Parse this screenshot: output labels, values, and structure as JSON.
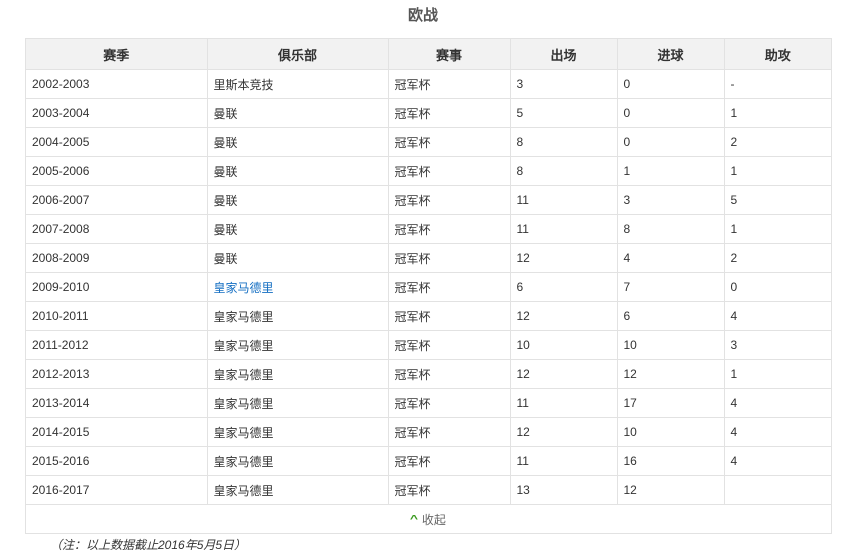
{
  "title": "欧战",
  "headers": [
    "赛季",
    "俱乐部",
    "赛事",
    "出场",
    "进球",
    "助攻"
  ],
  "rows": [
    [
      "2002-2003",
      "里斯本竞技",
      "冠军杯",
      "3",
      "0",
      "-"
    ],
    [
      "2003-2004",
      "曼联",
      "冠军杯",
      "5",
      "0",
      "1"
    ],
    [
      "2004-2005",
      "曼联",
      "冠军杯",
      "8",
      "0",
      "2"
    ],
    [
      "2005-2006",
      "曼联",
      "冠军杯",
      "8",
      "1",
      "1"
    ],
    [
      "2006-2007",
      "曼联",
      "冠军杯",
      "11",
      "3",
      "5"
    ],
    [
      "2007-2008",
      "曼联",
      "冠军杯",
      "11",
      "8",
      "1"
    ],
    [
      "2008-2009",
      "曼联",
      "冠军杯",
      "12",
      "4",
      "2"
    ],
    [
      "2009-2010",
      "皇家马德里",
      "冠军杯",
      "6",
      "7",
      "0"
    ],
    [
      "2010-2011",
      "皇家马德里",
      "冠军杯",
      "12",
      "6",
      "4"
    ],
    [
      "2011-2012",
      "皇家马德里",
      "冠军杯",
      "10",
      "10",
      "3"
    ],
    [
      "2012-2013",
      "皇家马德里",
      "冠军杯",
      "12",
      "12",
      "1"
    ],
    [
      "2013-2014",
      "皇家马德里",
      "冠军杯",
      "11",
      "17",
      "4"
    ],
    [
      "2014-2015",
      "皇家马德里",
      "冠军杯",
      "12",
      "10",
      "4"
    ],
    [
      "2015-2016",
      "皇家马德里",
      "冠军杯",
      "11",
      "16",
      "4"
    ],
    [
      "2016-2017",
      "皇家马德里",
      "冠军杯",
      "13",
      "12",
      ""
    ]
  ],
  "linked_club_row": 7,
  "collapse_label": "收起",
  "note": "（注：以上数据截止2016年5月5日）",
  "colors": {
    "link": "#136ec2",
    "chevron": "#3a9a1e",
    "header_bg": "#f2f2f2"
  }
}
